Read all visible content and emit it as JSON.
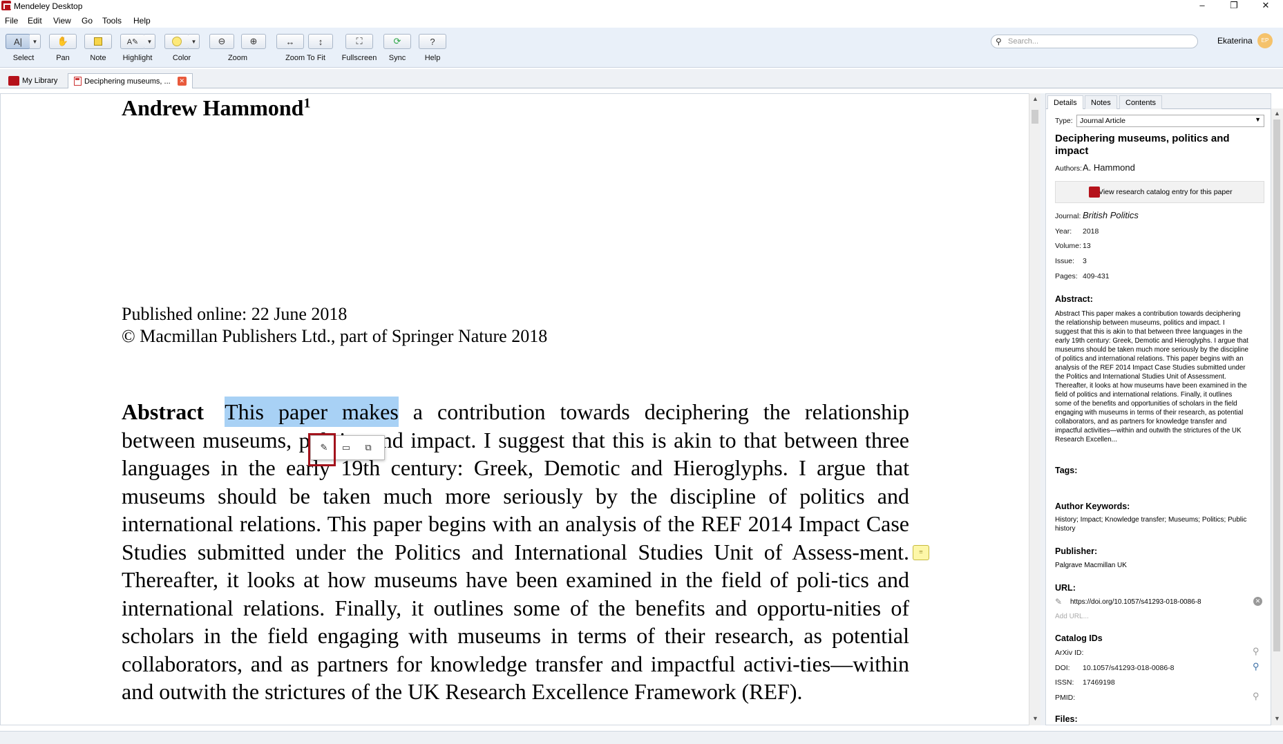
{
  "window": {
    "title": "Mendeley Desktop",
    "minimize": "–",
    "restore": "❐",
    "close": "✕"
  },
  "menu": [
    "File",
    "Edit",
    "View",
    "Go",
    "Tools",
    "Help"
  ],
  "toolbar": {
    "select": "Select",
    "pan": "Pan",
    "note": "Note",
    "highlight": "Highlight",
    "color": "Color",
    "zoom": "Zoom",
    "zoom_to_fit": "Zoom To Fit",
    "fullscreen": "Fullscreen",
    "sync": "Sync",
    "help": "Help"
  },
  "search": {
    "placeholder": "Search..."
  },
  "user": {
    "name": "Ekaterina",
    "initials": "EP"
  },
  "tabs": {
    "library": "My Library",
    "document": "Deciphering museums, ..."
  },
  "document": {
    "author": "Andrew Hammond",
    "author_sup": "1",
    "published": "Published online: 22 June 2018",
    "copyright": "© Macmillan Publishers Ltd., part of Springer Nature 2018",
    "abstract_heading": "Abstract",
    "abstract_highlight": "This paper makes",
    "abstract_rest": " a contribution towards deciphering the relationship between museums, politics and impact. I suggest that this is akin to that between three languages in the early 19th century: Greek, Demotic and Hieroglyphs. I argue that museums should be taken much more seriously by the discipline of politics and international relations. This paper begins with an analysis of the REF 2014 Impact Case Studies submitted under the Politics and International Studies Unit of Assess-ment. Thereafter, it looks at how museums have been examined in the field of poli-tics and international relations. Finally, it outlines some of the benefits and opportu-nities of scholars in the field engaging with museums in terms of their research, as potential collaborators, and as partners for knowledge transfer and impactful activi-ties—within and outwith the strictures of the UK Research Excellence Framework (REF)."
  },
  "side": {
    "tabs": [
      "Details",
      "Notes",
      "Contents"
    ],
    "type_label": "Type:",
    "type_value": "Journal Article",
    "title": "Deciphering museums, politics and impact",
    "authors_label": "Authors:",
    "authors_value": "A. Hammond",
    "catalog_button": "View research catalog entry for this paper",
    "journal_label": "Journal:",
    "journal_value": "British Politics",
    "year_label": "Year:",
    "year_value": "2018",
    "volume_label": "Volume:",
    "volume_value": "13",
    "issue_label": "Issue:",
    "issue_value": "3",
    "pages_label": "Pages:",
    "pages_value": "409-431",
    "abstract_head": "Abstract:",
    "abstract_text": "Abstract This paper makes a contribution towards deciphering the relationship between museums, politics and impact. I suggest that this is akin to that between three languages in the early 19th century: Greek, Demotic and Hieroglyphs. I argue that museums should be taken much more seriously by the discipline of politics and international relations. This paper begins with an analysis of the REF 2014 Impact Case Studies submitted under the Politics and International Studies Unit of Assessment. Thereafter, it looks at how museums have been examined in the field of politics and international relations. Finally, it outlines some of the benefits and opportunities of scholars in the field engaging with museums in terms of their research, as potential collaborators, and as partners for knowledge transfer and impactful activities—within and outwith the strictures of the UK Research Excellen...",
    "tags_head": "Tags:",
    "keywords_head": "Author Keywords:",
    "keywords": "History; Impact; Knowledge transfer; Museums; Politics; Public history",
    "publisher_head": "Publisher:",
    "publisher": "Palgrave Macmillan UK",
    "url_head": "URL:",
    "url": "https://doi.org/10.1057/s41293-018-0086-8",
    "add_url": "Add URL...",
    "catalog_head": "Catalog IDs",
    "arxiv_label": "ArXiv ID:",
    "doi_label": "DOI:",
    "doi_value": "10.1057/s41293-018-0086-8",
    "issn_label": "ISSN:",
    "issn_value": "17469198",
    "pmid_label": "PMID:",
    "files_head": "Files:"
  }
}
